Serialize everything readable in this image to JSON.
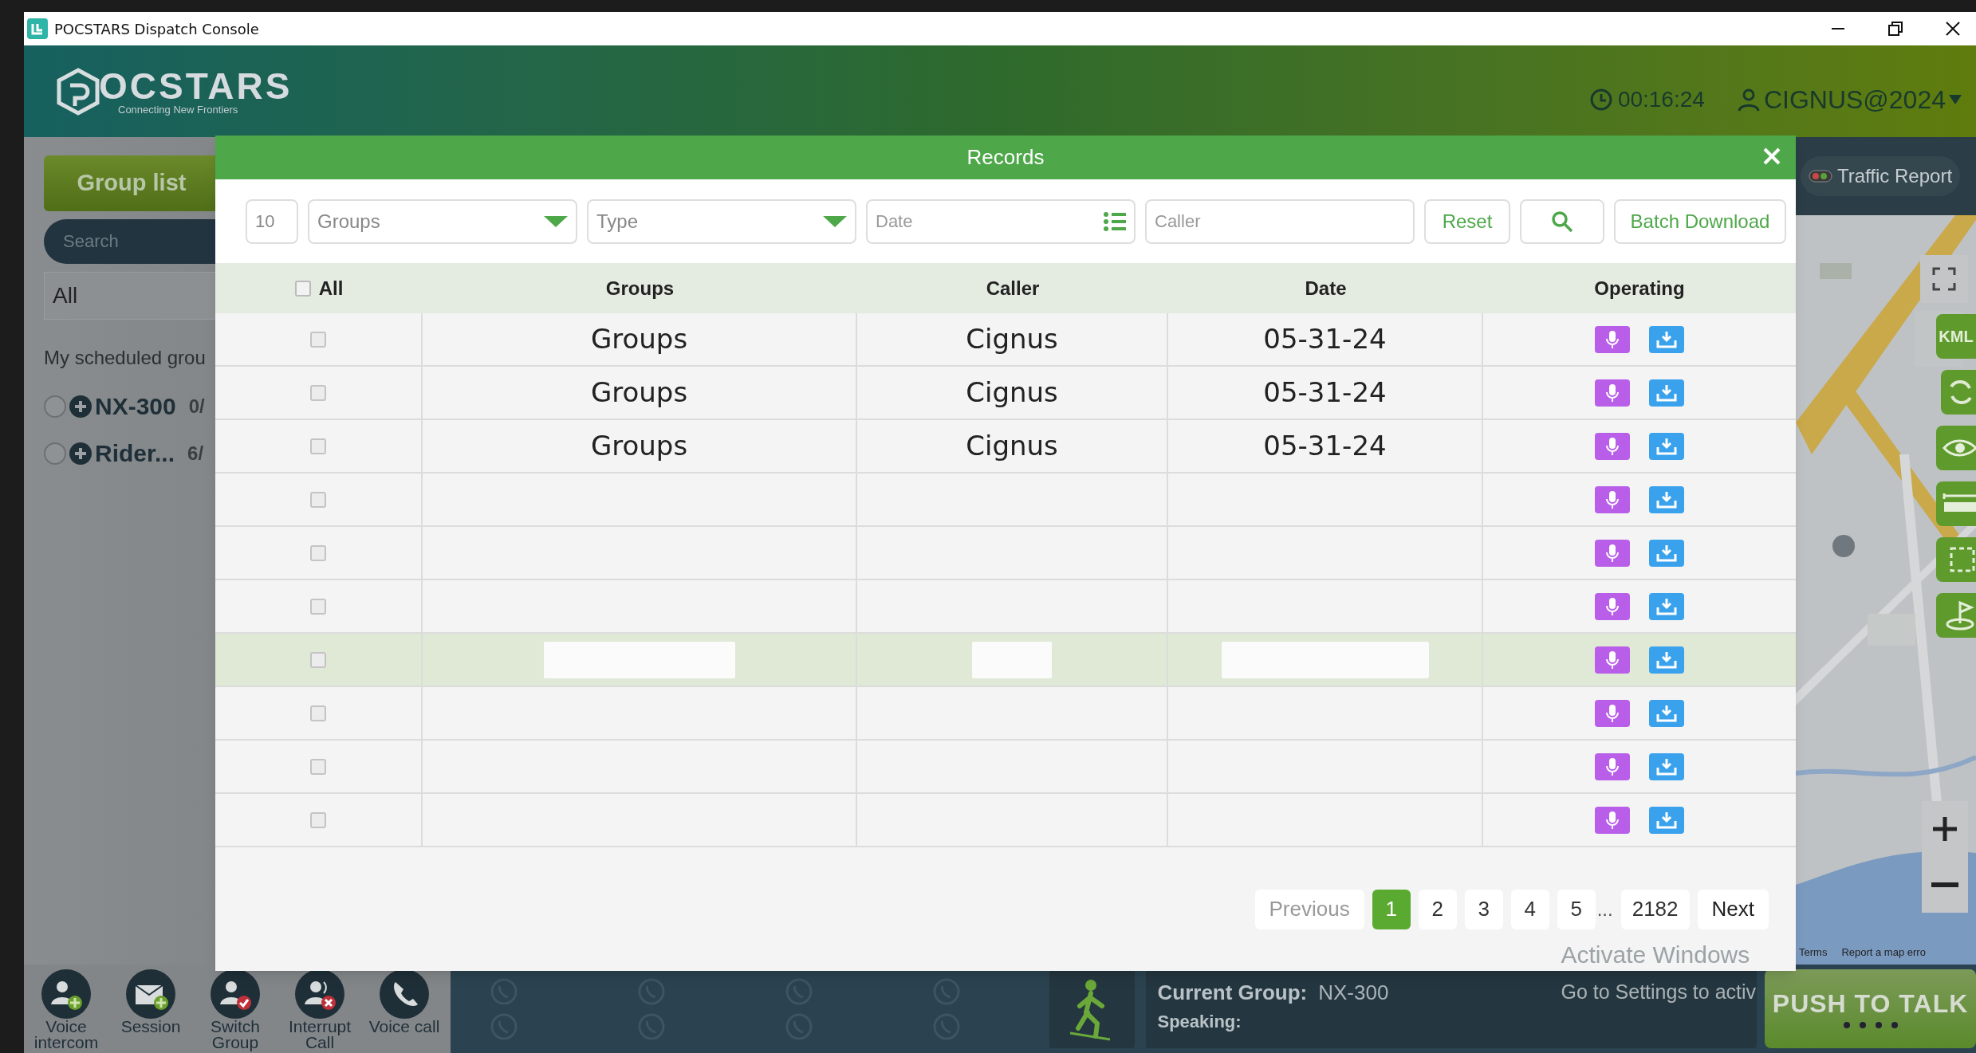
{
  "window": {
    "title": "POCSTARS Dispatch Console"
  },
  "header": {
    "logo": "OCSTARS",
    "tagline": "Connecting New Frontiers",
    "timer": "00:16:24",
    "user": "CIGNUS@2024"
  },
  "sidebar": {
    "group_list": "Group list",
    "search_placeholder": "Search",
    "filter": "All",
    "section": "My scheduled grou",
    "groups": [
      {
        "name": "NX-300",
        "count": "0/",
        "selected": false
      },
      {
        "name": "Rider...",
        "count": "6/",
        "selected": false
      }
    ]
  },
  "map": {
    "kind": "picture",
    "traffic_report": "Traffic Report",
    "kml": "KML",
    "terms": "Terms",
    "report": "Report a map erro"
  },
  "records": {
    "title": "Records",
    "page_size": "10",
    "groups_select": "Groups",
    "type_select": "Type",
    "date_placeholder": "Date",
    "caller_placeholder": "Caller",
    "reset": "Reset",
    "batch_download": "Batch Download",
    "all_checked": false,
    "columns": [
      "All",
      "Groups",
      "Caller",
      "Date",
      "Operating"
    ],
    "rows": [
      {
        "checked": false,
        "highlighted": false,
        "groups": "Groups",
        "caller": "Cignus",
        "date": "05-31-24"
      },
      {
        "checked": false,
        "highlighted": false,
        "groups": "Groups",
        "caller": "Cignus",
        "date": "05-31-24"
      },
      {
        "checked": false,
        "highlighted": false,
        "groups": "Groups",
        "caller": "Cignus",
        "date": "05-31-24"
      },
      {
        "checked": false,
        "highlighted": false
      },
      {
        "checked": false,
        "highlighted": false
      },
      {
        "checked": false,
        "highlighted": false
      },
      {
        "checked": false,
        "highlighted": true,
        "redacted": true
      },
      {
        "checked": false,
        "highlighted": false
      },
      {
        "checked": false,
        "highlighted": false
      },
      {
        "checked": false,
        "highlighted": false
      }
    ],
    "pagination": {
      "previous": "Previous",
      "pages": [
        {
          "label": "1",
          "selected": true
        },
        {
          "label": "2",
          "selected": false
        },
        {
          "label": "3",
          "selected": false
        },
        {
          "label": "4",
          "selected": false
        },
        {
          "label": "5",
          "selected": false
        }
      ],
      "ellipsis": "...",
      "last": "2182",
      "next": "Next"
    }
  },
  "actions": [
    {
      "label": "Voice intercom",
      "kind": "add-person"
    },
    {
      "label": "Session",
      "kind": "mail"
    },
    {
      "label": "Switch Group",
      "kind": "check-person"
    },
    {
      "label": "Interrupt Call",
      "kind": "cancel-person"
    },
    {
      "label": "Voice call",
      "kind": "phone"
    }
  ],
  "status": {
    "current_group_label": "Current Group:",
    "current_group": "NX-300",
    "speaking_label": "Speaking:"
  },
  "os_notice": {
    "title": "Activate Windows",
    "text": "Go to Settings to activ"
  },
  "push_to_talk": "PUSH TO TALK"
}
